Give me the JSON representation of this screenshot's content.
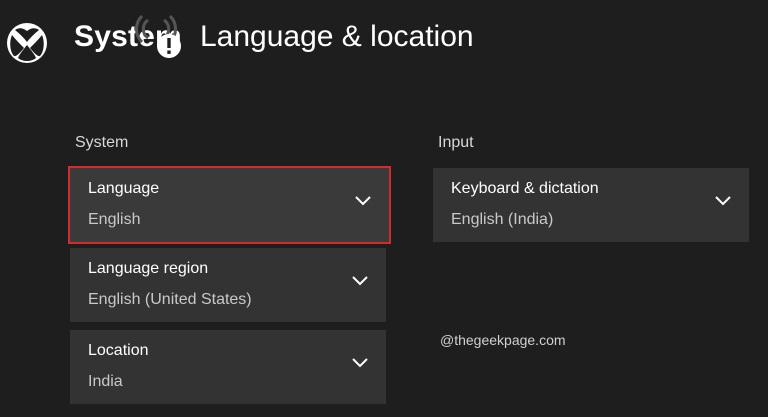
{
  "header": {
    "section": "System",
    "title": "Language & location"
  },
  "system_column": {
    "heading": "System",
    "items": [
      {
        "label": "Language",
        "value": "English"
      },
      {
        "label": "Language region",
        "value": "English (United States)"
      },
      {
        "label": "Location",
        "value": "India"
      }
    ]
  },
  "input_column": {
    "heading": "Input",
    "items": [
      {
        "label": "Keyboard & dictation",
        "value": "English (India)"
      }
    ]
  },
  "watermark": "@thegeekpage.com",
  "colors": {
    "background": "#1e1e1e",
    "tile": "#333333",
    "highlight": "#d32c2c"
  },
  "icons": [
    "xbox-logo-icon",
    "notification-icon",
    "chevron-down-icon"
  ]
}
